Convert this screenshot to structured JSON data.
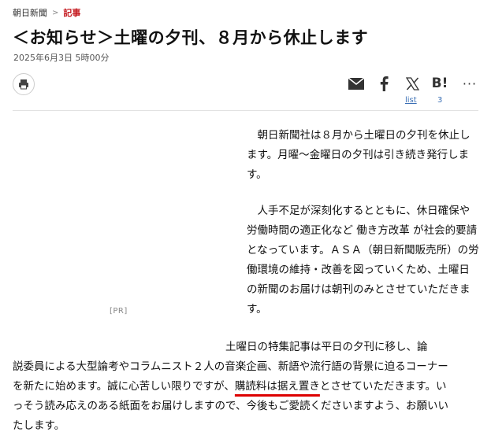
{
  "breadcrumb": {
    "home": "朝日新聞",
    "separator": ">",
    "current": "記事"
  },
  "article": {
    "title": "＜お知らせ＞土曜の夕刊、８月から休止します",
    "date": "2025年6月3日 5時00分",
    "paragraph1": "　朝日新聞社は８月から土曜日の夕刊を休止します。月曜～金曜日の夕刊は引き続き発行します。",
    "paragraph2": "　人手不足が深刻化するとともに、休日確保や労働時間の適正化など 働き方改革 が社会的要請となっています。ＡＳＡ（朝日新聞販売所）の労働環境の維持・改善を図っていくため、土曜日の新聞のお届けは朝刊のみとさせていただきます。",
    "paragraph3": {
      "line1": "　　　　　　　　　　　　　　　　　　　　土曜日の特集記事は平日の夕刊に移し、論",
      "line2": "説委員による大型論考やコラムニスト２人の音楽企画、新語や流行語の背景に迫るコーナー",
      "line3_before": "を新たに始めます。誠に心苦しい限りですが、",
      "line3_mark": "購読料は据え置き",
      "line3_after": "とさせていただきます。い",
      "line4": "っそう読み応えのある紙面をお届けしますので、今後もご愛読くださいますよう、お願いい",
      "line5": "たします。"
    }
  },
  "ad": {
    "label": "[PR]"
  },
  "share": {
    "icons": [
      "print-icon",
      "mail-icon",
      "facebook-icon",
      "x-icon",
      "hatena-bookmark-icon",
      "more-icon"
    ],
    "hatena_label": "B!",
    "more_label": "···",
    "list_label": "list",
    "bookmark_count": "3"
  },
  "colors": {
    "accent": "#c4161c",
    "link": "#3a6fb5",
    "highlight_underline": "#dd0000"
  }
}
